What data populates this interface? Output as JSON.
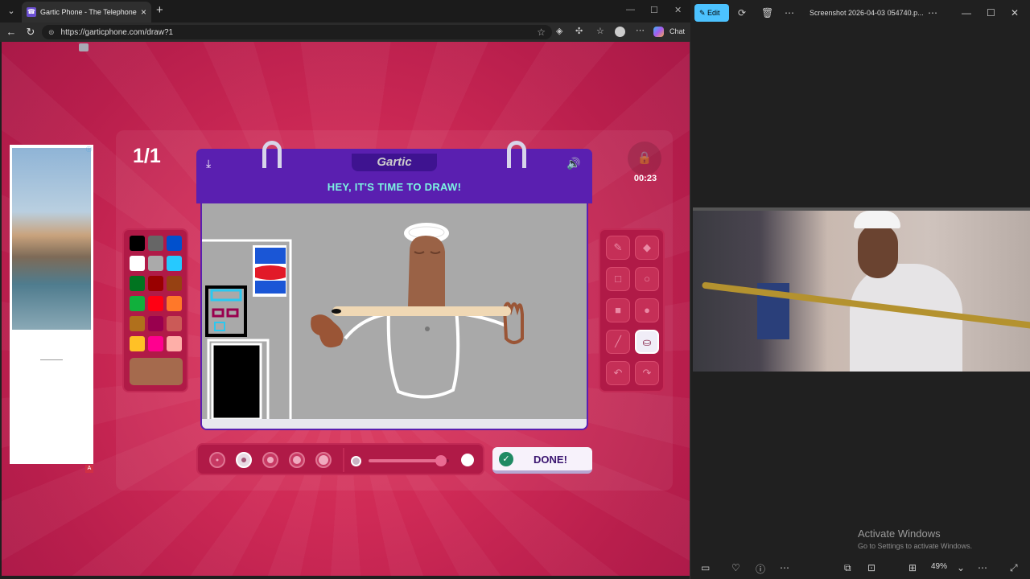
{
  "browser": {
    "tab_title": "Gartic Phone - The Telephone Game",
    "tab_close": "×",
    "new_tab": "+",
    "url": "https://garticphone.com/draw?1",
    "chat_label": "Chat"
  },
  "game": {
    "round": "1/1",
    "timer": "00:23",
    "logo": "Gartic",
    "headline": "HEY, IT'S TIME TO DRAW!",
    "done_label": "DONE!",
    "palette": [
      "#000000",
      "#666666",
      "#0050cd",
      "#ffffff",
      "#aaaaaa",
      "#26c9ff",
      "#017420",
      "#990000",
      "#964112",
      "#11b03c",
      "#ff0013",
      "#ff7829",
      "#b0701c",
      "#99004e",
      "#cb5a57",
      "#ffc126",
      "#ff008f",
      "#feafa8"
    ],
    "current_color": "#a56a4d",
    "brush_sizes_count": 5,
    "selected_brush_index": 1,
    "opacity_percent": 90
  },
  "ad": {
    "choices_badge": "ⓘ",
    "badge": "A"
  },
  "viewer": {
    "edit_label": "Edit",
    "filename": "Screenshot 2026-04-03 054740.p...",
    "zoom": "49%",
    "activate_title": "Activate Windows",
    "activate_sub": "Go to Settings to activate Windows."
  }
}
